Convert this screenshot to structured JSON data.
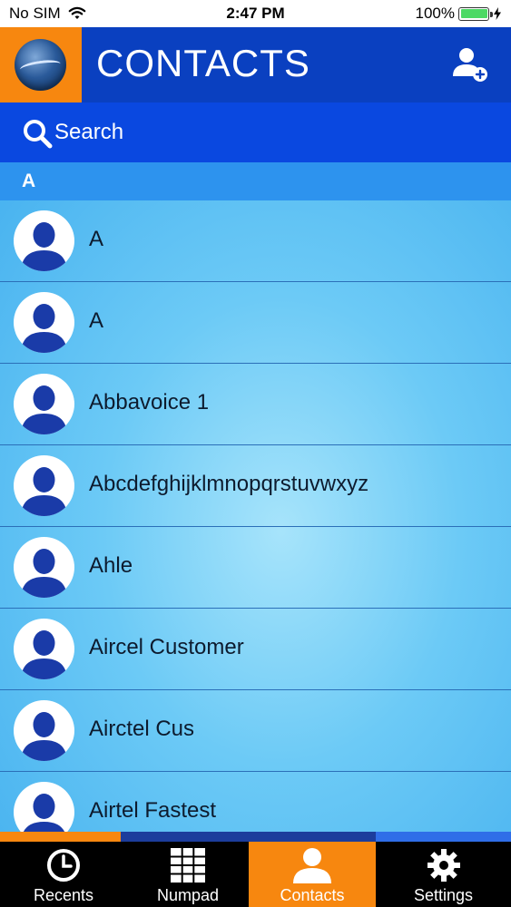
{
  "status_bar": {
    "carrier": "No SIM",
    "time": "2:47 PM",
    "battery": "100%"
  },
  "header": {
    "title": "CONTACTS",
    "add_contact_icon": "add-person-icon",
    "logo_icon": "app-logo-icon"
  },
  "search": {
    "placeholder": "Search"
  },
  "section": {
    "letter": "A"
  },
  "contacts": [
    {
      "name": "A"
    },
    {
      "name": "A"
    },
    {
      "name": "Abbavoice 1"
    },
    {
      "name": "Abcdefghijklmnopqrstuvwxyz"
    },
    {
      "name": "Ahle"
    },
    {
      "name": "Aircel Customer"
    },
    {
      "name": "Airctel Cus"
    },
    {
      "name": "Airtel Fastest"
    }
  ],
  "tabs": [
    {
      "label": "Recents",
      "icon": "clock-icon",
      "active": false
    },
    {
      "label": "Numpad",
      "icon": "keypad-grid-icon",
      "active": false
    },
    {
      "label": "Contacts",
      "icon": "person-icon",
      "active": true
    },
    {
      "label": "Settings",
      "icon": "gear-icon",
      "active": false
    }
  ],
  "colors": {
    "header_blue": "#0a40c0",
    "search_blue": "#0a48e0",
    "accent_orange": "#f7870f",
    "section_blue": "#2d93ee",
    "avatar_silhouette": "#1a3ba8"
  }
}
